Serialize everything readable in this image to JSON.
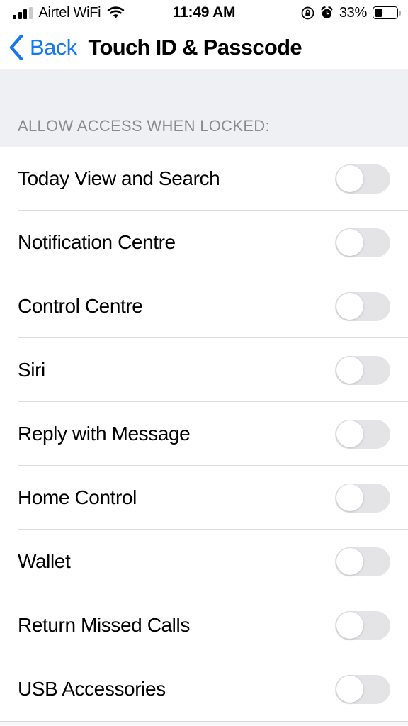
{
  "status_bar": {
    "carrier": "Airtel WiFi",
    "time": "11:49 AM",
    "battery_percent": "33%",
    "battery_level": 33,
    "signal_bars_filled": 3,
    "signal_bars_total": 4,
    "icons": [
      "signal-bars-icon",
      "wifi-icon",
      "rotation-lock-icon",
      "alarm-clock-icon",
      "battery-icon"
    ]
  },
  "nav_bar": {
    "back_label": "Back",
    "back_icon": "chevron-left-icon",
    "title": "Touch ID & Passcode"
  },
  "section": {
    "header": "ALLOW ACCESS WHEN LOCKED:"
  },
  "rows": [
    {
      "label": "Today View and Search",
      "toggle": "off"
    },
    {
      "label": "Notification Centre",
      "toggle": "off"
    },
    {
      "label": "Control Centre",
      "toggle": "off"
    },
    {
      "label": "Siri",
      "toggle": "off"
    },
    {
      "label": "Reply with Message",
      "toggle": "off"
    },
    {
      "label": "Home Control",
      "toggle": "off"
    },
    {
      "label": "Wallet",
      "toggle": "off"
    },
    {
      "label": "Return Missed Calls",
      "toggle": "off"
    },
    {
      "label": "USB Accessories",
      "toggle": "off"
    }
  ],
  "colors": {
    "accent_blue": "#1578ed",
    "section_bg": "#eff0f4",
    "toggle_off_track": "#e4e4e6",
    "toggle_on_track": "#4cd964",
    "separator": "#dcdcdf",
    "header_text": "#8a8a8f"
  }
}
